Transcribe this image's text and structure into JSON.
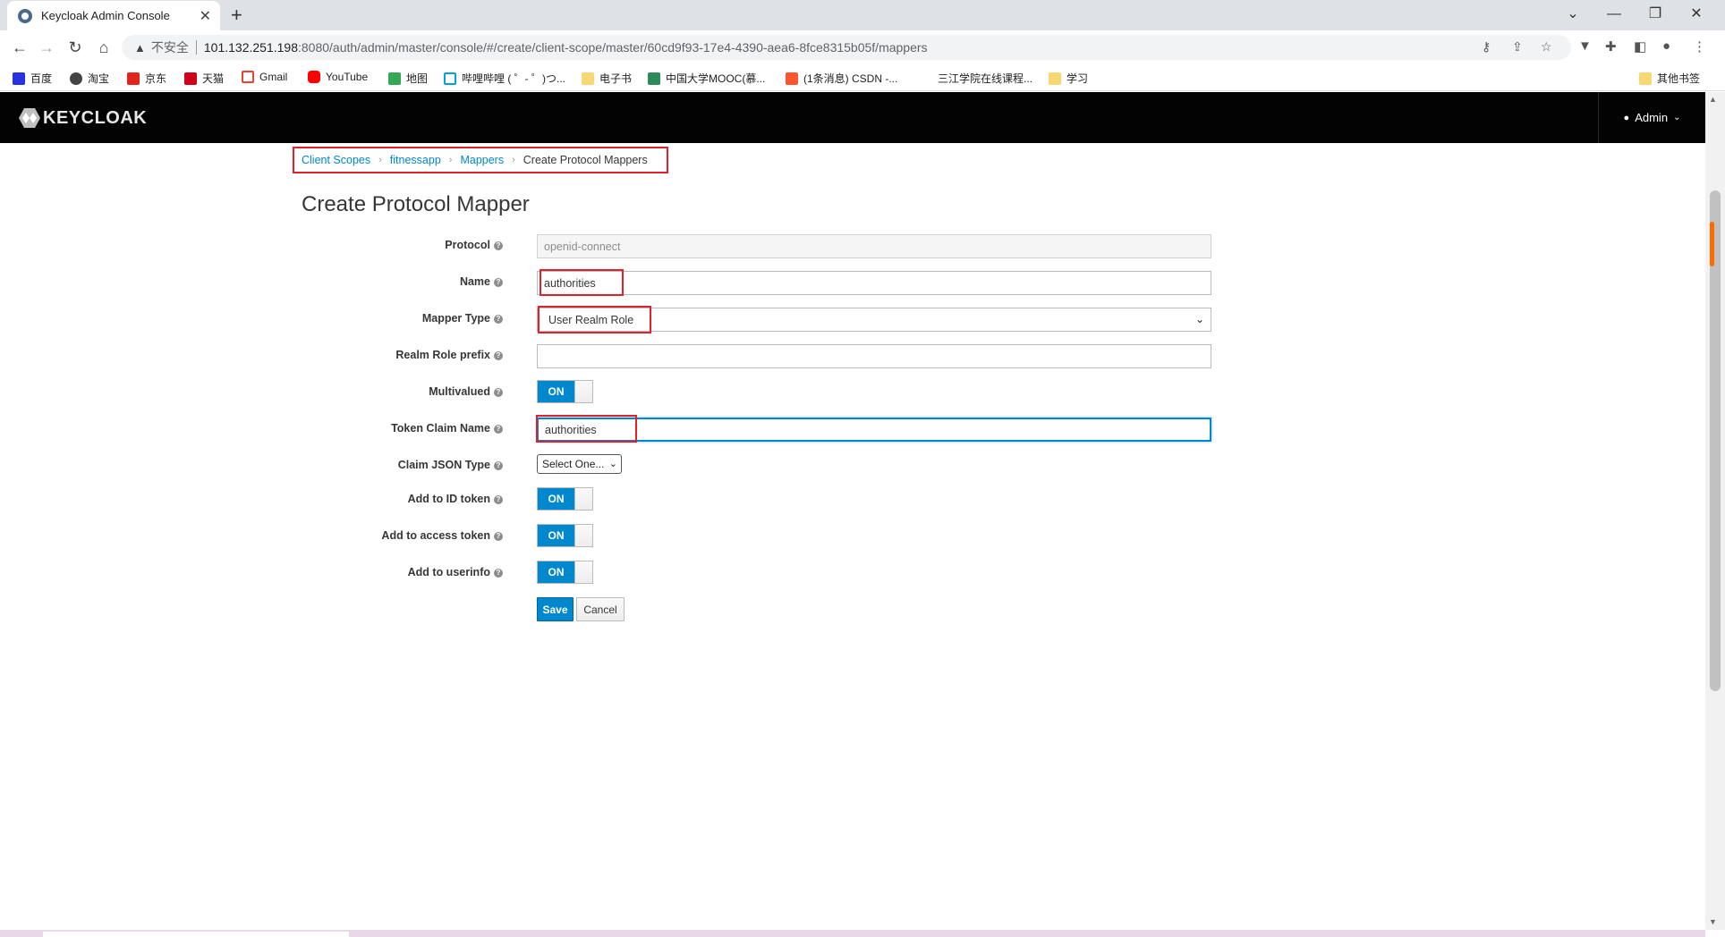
{
  "browser": {
    "tab_title": "Keycloak Admin Console",
    "tab_close": "✕",
    "new_tab": "+",
    "window_controls": [
      "⌄",
      "—",
      "❐",
      "✕"
    ],
    "insecure_label": "不安全",
    "url_host": "101.132.251.198",
    "url_path": ":8080/auth/admin/master/console/#/create/client-scope/master/60cd9f93-17e4-4390-aea6-8fce8315b05f/mappers",
    "bookmarks": [
      {
        "label": "百度",
        "color": "#2932e1"
      },
      {
        "label": "淘宝",
        "color": "#444444"
      },
      {
        "label": "京东",
        "color": "#e1251b"
      },
      {
        "label": "天猫",
        "color": "#d0021b"
      },
      {
        "label": "Gmail",
        "color": "#ea4335"
      },
      {
        "label": "YouTube",
        "color": "#ff0000"
      },
      {
        "label": "地图",
        "color": "#34a853"
      },
      {
        "label": "哔哩哔哩 ( ゜- ゜)つ...",
        "color": "#00a1d6"
      },
      {
        "label": "电子书",
        "color": "#f7d774"
      },
      {
        "label": "中国大学MOOC(慕...",
        "color": "#2e8b57"
      },
      {
        "label": "(1条消息) CSDN -...",
        "color": "#fc5531"
      },
      {
        "label": "三江学院在线课程...",
        "color": "#ffffff"
      },
      {
        "label": "学习",
        "color": "#f7d774"
      }
    ],
    "other_bookmarks": "其他书签"
  },
  "header": {
    "logo_text": "KEYCLOAK",
    "user_label": "Admin"
  },
  "breadcrumb": {
    "items": [
      "Client Scopes",
      "fitnessapp",
      "Mappers"
    ],
    "current": "Create Protocol Mappers"
  },
  "page_title": "Create Protocol Mapper",
  "form": {
    "protocol": {
      "label": "Protocol",
      "value": "openid-connect"
    },
    "name": {
      "label": "Name",
      "value": "authorities"
    },
    "mapper_type": {
      "label": "Mapper Type",
      "value": "User Realm Role"
    },
    "realm_role_prefix": {
      "label": "Realm Role prefix",
      "value": ""
    },
    "multivalued": {
      "label": "Multivalued",
      "state": "ON"
    },
    "token_claim_name": {
      "label": "Token Claim Name",
      "value": "authorities"
    },
    "claim_json_type": {
      "label": "Claim JSON Type",
      "value": "Select One..."
    },
    "add_to_id_token": {
      "label": "Add to ID token",
      "state": "ON"
    },
    "add_to_access_token": {
      "label": "Add to access token",
      "state": "ON"
    },
    "add_to_userinfo": {
      "label": "Add to userinfo",
      "state": "ON"
    },
    "save_label": "Save",
    "cancel_label": "Cancel"
  },
  "colors": {
    "accent": "#0088ce",
    "annotation": "#e0212b",
    "header_bg": "#030303"
  }
}
